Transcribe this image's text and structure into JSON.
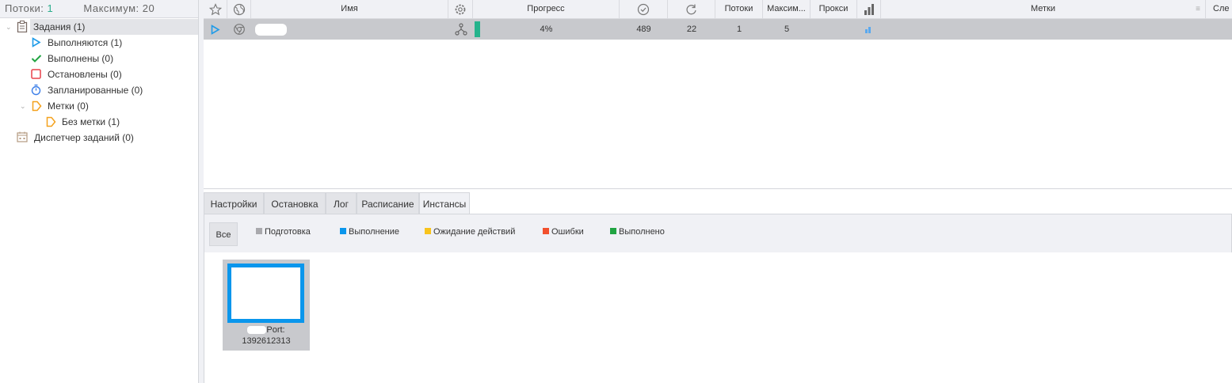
{
  "stats": {
    "threads_label": "Потоки:",
    "threads": "1",
    "max_label": "Максимум:",
    "max": "20"
  },
  "tree": [
    {
      "label": "Задания (1)",
      "icon": "clipboard-icon"
    },
    {
      "label": "Выполняются (1)",
      "icon": "play-icon"
    },
    {
      "label": "Выполнены (0)",
      "icon": "check-icon"
    },
    {
      "label": "Остановлены (0)",
      "icon": "stop-icon"
    },
    {
      "label": "Запланированные (0)",
      "icon": "stopwatch-icon"
    },
    {
      "label": "Метки (0)",
      "icon": "tag-icon"
    },
    {
      "label": "Без метки (1)",
      "icon": "tag-icon"
    },
    {
      "label": "Диспетчер заданий (0)",
      "icon": "calendar-icon"
    }
  ],
  "grid": {
    "headers": {
      "name": "Имя",
      "progress": "Прогресс",
      "threads": "Потоки",
      "max": "Максим...",
      "proxy": "Прокси",
      "tags": "Метки",
      "next": "Сле"
    },
    "row": {
      "progress": "4%",
      "progress_value": 4,
      "success": "489",
      "repeats": "22",
      "threads": "1",
      "max": "5"
    }
  },
  "tabs": [
    "Настройки",
    "Остановка",
    "Лог",
    "Расписание",
    "Инстансы"
  ],
  "filters": {
    "all": "Все",
    "items": [
      {
        "label": "Подготовка",
        "color": "#a9a9ad"
      },
      {
        "label": "Выполнение",
        "color": "#0a96ec"
      },
      {
        "label": "Ожидание действий",
        "color": "#f8c31c"
      },
      {
        "label": "Ошибки",
        "color": "#f2502d"
      },
      {
        "label": "Выполнено",
        "color": "#21a442"
      }
    ]
  },
  "instance": {
    "port_label": "Port:",
    "port": "1392612313"
  }
}
